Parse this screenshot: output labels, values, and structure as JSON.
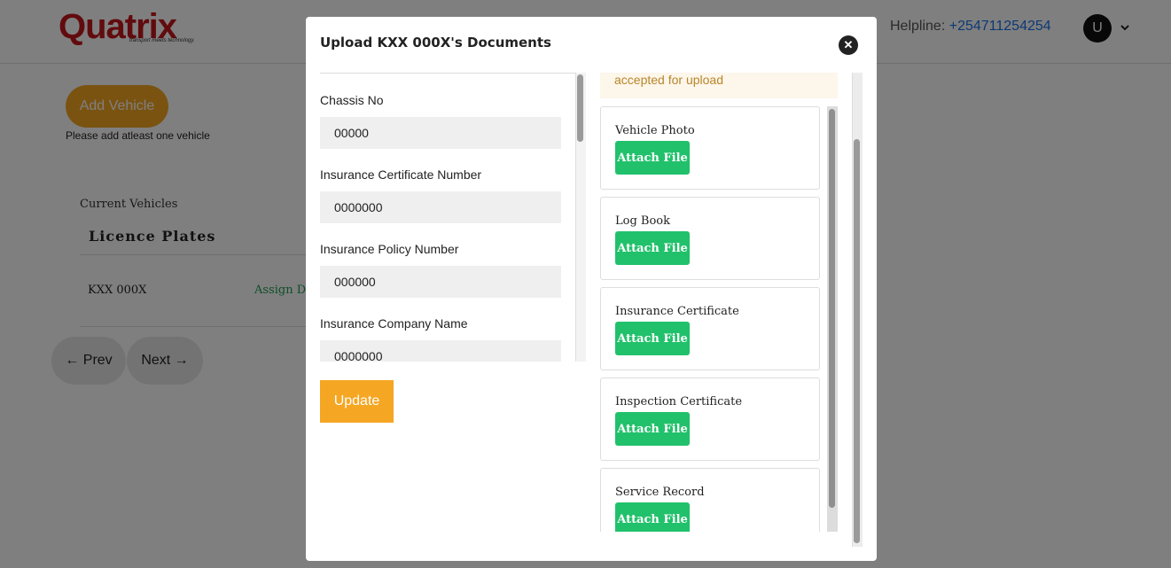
{
  "header": {
    "logo_text": "Quatrix",
    "logo_tagline": "transport meets technology.",
    "helpline_label": "Helpline:",
    "helpline_number": "+254711254254",
    "avatar_initial": "U",
    "caret_icon": "chevron-down-icon"
  },
  "page": {
    "add_vehicle_label": "Add Vehicle",
    "add_hint": "Please add atleast one vehicle",
    "current_vehicles_title": "Current Vehicles",
    "column_header": "Licence Plates",
    "rows": [
      {
        "plate": "KXX 000X",
        "action": "Assign Dr"
      }
    ],
    "prev_label": "← Prev",
    "next_label": "Next →"
  },
  "modal": {
    "title": "Upload KXX 000X's Documents",
    "close_icon": "close-icon",
    "fields": [
      {
        "label": "Chassis No",
        "value": "00000"
      },
      {
        "label": "Insurance Certificate Number",
        "value": "0000000"
      },
      {
        "label": "Insurance Policy Number",
        "value": "000000"
      },
      {
        "label": "Insurance Company Name",
        "value": "0000000"
      }
    ],
    "update_label": "Update",
    "notice_text": "accepted for upload",
    "documents": [
      {
        "name": "Vehicle Photo",
        "button": "Attach File"
      },
      {
        "name": "Log Book",
        "button": "Attach File"
      },
      {
        "name": "Insurance Certificate",
        "button": "Attach File"
      },
      {
        "name": "Inspection Certificate",
        "button": "Attach File"
      },
      {
        "name": "Service Record",
        "button": "Attach File"
      }
    ]
  },
  "colors": {
    "accent_orange": "#f5a623",
    "attach_green": "#21c16b",
    "brand_red": "#c4161c",
    "link_blue": "#1a73e8"
  }
}
